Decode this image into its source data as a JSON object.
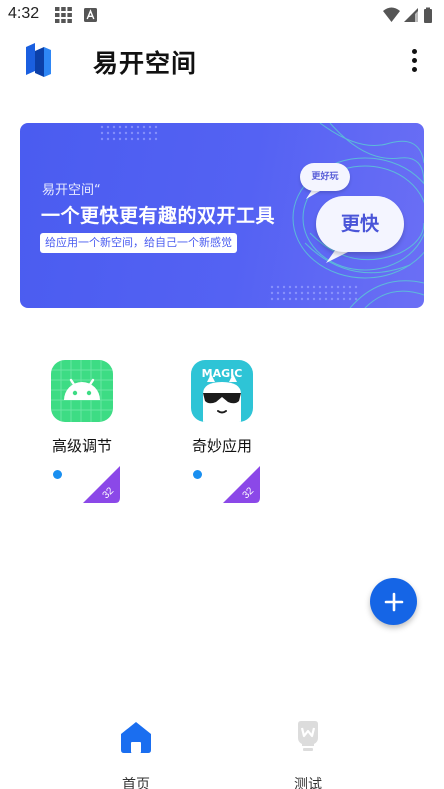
{
  "status_bar": {
    "time": "4:32",
    "icons": [
      "grid-icon",
      "a-icon",
      "wifi-icon",
      "signal-icon",
      "battery-icon"
    ]
  },
  "app_bar": {
    "title": "易开空间",
    "logo": "app-logo",
    "menu_icon": "more-vert-icon"
  },
  "banner": {
    "subtitle": "易开空间“",
    "headline": "一个更快更有趣的双开工具",
    "tagline": "给应用一个新空间，给自己一个新感觉",
    "bubble_small": "更好玩",
    "bubble_big": "更快",
    "colors": {
      "bg": "#4a5cf0",
      "accent": "#5ad6d0"
    }
  },
  "apps": [
    {
      "name": "高级调节",
      "icon": "android-icon",
      "badge": "32",
      "icon_color": "#3ddc84"
    },
    {
      "name": "奇妙应用",
      "icon": "magic-icon",
      "badge": "32",
      "icon_color": "#2ec4d6",
      "icon_text": "MAGIC"
    }
  ],
  "fab": {
    "icon": "plus-icon",
    "color": "#1565e6"
  },
  "bottom_nav": {
    "items": [
      {
        "label": "首页",
        "icon": "home-icon",
        "active": true
      },
      {
        "label": "测试",
        "icon": "bulb-icon",
        "active": false
      }
    ]
  }
}
